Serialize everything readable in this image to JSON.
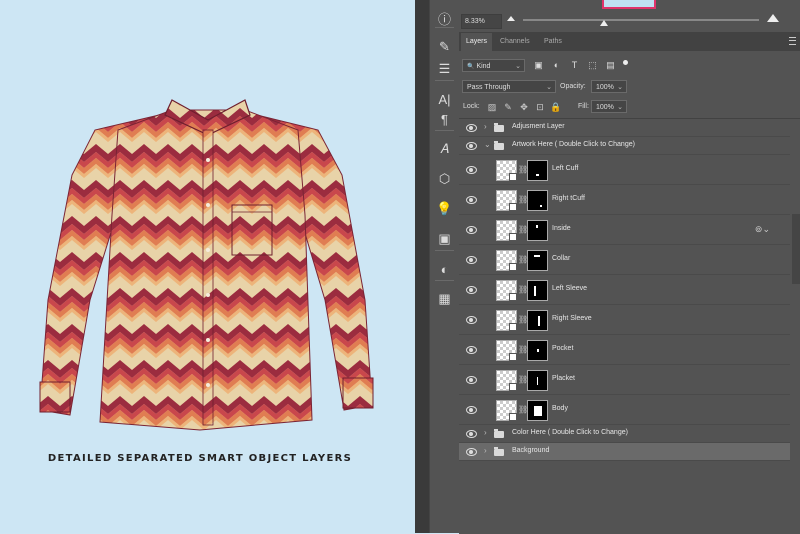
{
  "caption": "DETAILED SEPARATED SMART OBJECT LAYERS",
  "colors": {
    "canvas_bg": "#cde6f4",
    "panel_bg": "#535353",
    "shirt_red": "#9b2c3f",
    "shirt_orange": "#d97a4b",
    "shirt_cream": "#e8d3a8"
  },
  "navigator": {
    "zoom": "8.33%"
  },
  "tools": [
    {
      "icon": "info-icon",
      "glyph": "ⓘ"
    },
    {
      "icon": "brush-settings-icon",
      "glyph": "✎"
    },
    {
      "icon": "adjust-sliders-icon",
      "glyph": "☰"
    },
    {
      "icon": "character-icon",
      "glyph": "A|"
    },
    {
      "icon": "paragraph-icon",
      "glyph": "¶"
    },
    {
      "icon": "glyph-icon",
      "glyph": "𝐴"
    },
    {
      "icon": "3d-cube-icon",
      "glyph": "⬡"
    },
    {
      "icon": "lightbulb-icon",
      "glyph": "💡"
    },
    {
      "icon": "document-icon",
      "glyph": "▣"
    },
    {
      "icon": "adjustment-circle-icon",
      "glyph": "◐"
    },
    {
      "icon": "libraries-icon",
      "glyph": "▦"
    }
  ],
  "tabs": [
    "Layers",
    "Channels",
    "Paths"
  ],
  "filter": {
    "label": "Kind",
    "search_glyph": "🔍",
    "icons": [
      "image-filter-icon",
      "adjustment-filter-icon",
      "type-filter-icon",
      "shape-filter-icon",
      "smart-object-filter-icon"
    ],
    "glyphs": [
      "▣",
      "◐",
      "T",
      "⬚",
      "▤"
    ]
  },
  "blend": {
    "mode": "Pass Through",
    "opacity_label": "Opacity:",
    "opacity": "100%"
  },
  "lock": {
    "label": "Lock:",
    "fill_label": "Fill:",
    "fill": "100%",
    "icons": [
      "lock-pixels-icon",
      "lock-paint-icon",
      "lock-move-icon",
      "lock-artboard-icon",
      "lock-all-icon"
    ],
    "glyphs": [
      "▨",
      "✎",
      "✥",
      "⊡",
      "🔒"
    ]
  },
  "layers": [
    {
      "name": "Adjusment Layer",
      "type": "group",
      "expanded": false
    },
    {
      "name": "Artwork Here ( Double Click to Change)",
      "type": "group",
      "expanded": true
    },
    {
      "name": "Left Cuff",
      "type": "smart",
      "mask": "left-cuff"
    },
    {
      "name": "Right tCuff",
      "type": "smart",
      "mask": "right-cuff"
    },
    {
      "name": "Inside",
      "type": "smart",
      "mask": "inside",
      "linked": true
    },
    {
      "name": "Collar",
      "type": "smart",
      "mask": "collar"
    },
    {
      "name": "Left Sleeve",
      "type": "smart",
      "mask": "left-sleeve"
    },
    {
      "name": "Right Sleeve",
      "type": "smart",
      "mask": "right-sleeve"
    },
    {
      "name": "Pocket",
      "type": "smart",
      "mask": "pocket"
    },
    {
      "name": "Placket",
      "type": "smart",
      "mask": "placket"
    },
    {
      "name": "Body",
      "type": "smart",
      "mask": "body"
    },
    {
      "name": "Color Here ( Double Click to Change)",
      "type": "group",
      "expanded": false
    },
    {
      "name": "Background",
      "type": "group",
      "expanded": false,
      "selected": true
    }
  ]
}
